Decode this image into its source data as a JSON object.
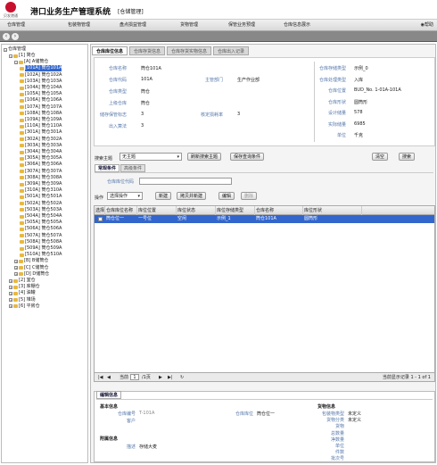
{
  "header": {
    "logo_text": "贝发港通",
    "title": "港口业务生产管理系统",
    "subtitle": "[仓储管理]"
  },
  "menu": {
    "items": [
      "仓库管理",
      "包装物管理",
      "盘点损益管理",
      "货物管理",
      "保管业务预理",
      "仓库信息展示"
    ],
    "help": "帮助"
  },
  "tree": {
    "root": "仓库管理",
    "nodes": [
      {
        "label": "[1] 简仓",
        "level": 1
      },
      {
        "label": "[A] A储筒仓",
        "level": 2
      },
      {
        "label": "[101A] 筒仓101A",
        "level": 3,
        "selected": true
      },
      {
        "label": "[102A] 筒仓102A",
        "level": 3
      },
      {
        "label": "[103A] 筒仓103A",
        "level": 3
      },
      {
        "label": "[104A] 筒仓104A",
        "level": 3
      },
      {
        "label": "[105A] 筒仓105A",
        "level": 3
      },
      {
        "label": "[106A] 筒仓106A",
        "level": 3
      },
      {
        "label": "[107A] 筒仓107A",
        "level": 3
      },
      {
        "label": "[108A] 筒仓108A",
        "level": 3
      },
      {
        "label": "[109A] 筒仓109A",
        "level": 3
      },
      {
        "label": "[110A] 筒仓110A",
        "level": 3
      },
      {
        "label": "[301A] 筒仓301A",
        "level": 3
      },
      {
        "label": "[302A] 筒仓302A",
        "level": 3
      },
      {
        "label": "[303A] 筒仓303A",
        "level": 3
      },
      {
        "label": "[304A] 筒仓304A",
        "level": 3
      },
      {
        "label": "[305A] 筒仓305A",
        "level": 3
      },
      {
        "label": "[306A] 筒仓306A",
        "level": 3
      },
      {
        "label": "[307A] 筒仓307A",
        "level": 3
      },
      {
        "label": "[308A] 筒仓308A",
        "level": 3
      },
      {
        "label": "[309A] 筒仓309A",
        "level": 3
      },
      {
        "label": "[310A] 筒仓310A",
        "level": 3
      },
      {
        "label": "[501A] 筒仓501A",
        "level": 3
      },
      {
        "label": "[502A] 筒仓502A",
        "level": 3
      },
      {
        "label": "[503A] 筒仓503A",
        "level": 3
      },
      {
        "label": "[504A] 筒仓504A",
        "level": 3
      },
      {
        "label": "[505A] 筒仓505A",
        "level": 3
      },
      {
        "label": "[506A] 筒仓506A",
        "level": 3
      },
      {
        "label": "[507A] 筒仓507A",
        "level": 3
      },
      {
        "label": "[508A] 筒仓508A",
        "level": 3
      },
      {
        "label": "[509A] 筒仓509A",
        "level": 3
      },
      {
        "label": "[510A] 筒仓510A",
        "level": 3
      },
      {
        "label": "[B] B储筒仓",
        "level": 2
      },
      {
        "label": "[C] C储筒仓",
        "level": 2
      },
      {
        "label": "[D] D储筒仓",
        "level": 2
      },
      {
        "label": "[2] 室仓",
        "level": 1
      },
      {
        "label": "[3] 库棚仓",
        "level": 1
      },
      {
        "label": "[4] 油罐",
        "level": 1
      },
      {
        "label": "[5] 堆场",
        "level": 1
      },
      {
        "label": "[6] 平房仓",
        "level": 1
      }
    ]
  },
  "tabs": [
    "仓库库位信息",
    "仓库存货信息",
    "仓库存货实物信息",
    "仓库出入记录"
  ],
  "info": {
    "left": [
      [
        "仓库名称",
        "筒仓101A"
      ],
      [
        "仓库代码",
        "101A"
      ],
      [
        "仓库类型",
        "筒仓"
      ],
      [
        "上级仓库",
        "筒仓"
      ],
      [
        "储存保管标志",
        "3"
      ],
      [
        "出入算法",
        "3"
      ]
    ],
    "mid": [
      [
        "主管部门",
        "生产作业部"
      ],
      [
        "核定损耗率",
        "3"
      ]
    ],
    "right": [
      [
        "仓库存储类型",
        "示例_0"
      ],
      [
        "仓库处理类型",
        "入库"
      ],
      [
        "仓库位置",
        "BUD_No. 1-01A-101A"
      ],
      [
        "仓库形状",
        "圆筒形"
      ],
      [
        "设计储量",
        "578"
      ],
      [
        "实际储量",
        "6985"
      ],
      [
        "单位",
        "千克"
      ]
    ]
  },
  "search": {
    "theme_label": "搜索主题",
    "theme_value": "无主题",
    "refresh": "刷新搜索主题",
    "save": "保存查询条件",
    "clear": "清空",
    "search": "搜索",
    "tab_common": "常规条件",
    "tab_adv": "高级条件",
    "field": "仓库库位代码"
  },
  "actions": {
    "label": "操作",
    "select": "选择操作",
    "new": "新建",
    "copy": "拷贝并新建",
    "edit": "编辑",
    "delete": "删除"
  },
  "grid": {
    "headers": [
      "选择",
      "仓库库位名称",
      "库位位置",
      "库位状态",
      "库位存储类型",
      "仓库名称",
      "库位形状"
    ],
    "rows": [
      [
        "",
        "筒仓位一",
        "一号位",
        "空闲",
        "示例_1",
        "筒仓101A",
        "圆筒形"
      ]
    ],
    "pager": {
      "page_label": "当前",
      "page": "1",
      "of": "/1页",
      "status": "当前显示记录 1 - 1 of 1"
    }
  },
  "detail": {
    "tab": "编辑信息",
    "basic": "基本信息",
    "basic_fields": [
      [
        "仓库编号",
        "T-101A"
      ],
      [
        "客户",
        ""
      ]
    ],
    "location": [
      [
        "仓库库位",
        "筒仓位一"
      ]
    ],
    "attach": "附属信息",
    "attach_fields": [
      [
        "描述",
        "存储大麦"
      ]
    ],
    "goods": "货物信息",
    "goods_fields": [
      [
        "包装物类型",
        "未定义"
      ],
      [
        "货物分类",
        "未定义"
      ],
      [
        "货物",
        ""
      ],
      [
        "总数量",
        ""
      ],
      [
        "净数量",
        ""
      ],
      [
        "单位",
        ""
      ],
      [
        "件数",
        ""
      ],
      [
        "批次号",
        ""
      ]
    ]
  }
}
